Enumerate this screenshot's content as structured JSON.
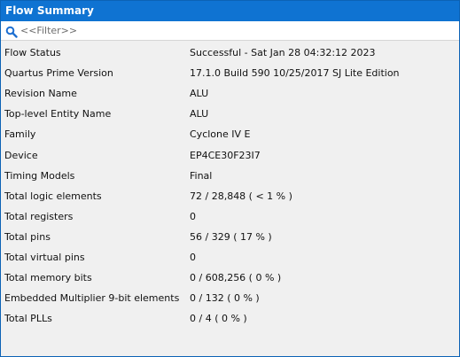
{
  "window": {
    "title": "Flow Summary"
  },
  "filter": {
    "placeholder": "<<Filter>>",
    "icon": "search-icon"
  },
  "summary": {
    "rows": [
      {
        "label": "Flow Status",
        "value": "Successful - Sat Jan 28 04:32:12 2023"
      },
      {
        "label": "Quartus Prime Version",
        "value": "17.1.0 Build 590 10/25/2017 SJ Lite Edition"
      },
      {
        "label": "Revision Name",
        "value": "ALU"
      },
      {
        "label": "Top-level Entity Name",
        "value": "ALU"
      },
      {
        "label": "Family",
        "value": "Cyclone IV E"
      },
      {
        "label": "Device",
        "value": "EP4CE30F23I7"
      },
      {
        "label": "Timing Models",
        "value": "Final"
      },
      {
        "label": "Total logic elements",
        "value": "72 / 28,848 ( < 1 % )"
      },
      {
        "label": "Total registers",
        "value": "0"
      },
      {
        "label": "Total pins",
        "value": "56 / 329 ( 17 % )"
      },
      {
        "label": "Total virtual pins",
        "value": "0"
      },
      {
        "label": "Total memory bits",
        "value": "0 / 608,256 ( 0 % )"
      },
      {
        "label": "Embedded Multiplier 9-bit elements",
        "value": "0 / 132 ( 0 % )"
      },
      {
        "label": "Total PLLs",
        "value": "0 / 4 ( 0 % )"
      }
    ]
  },
  "colors": {
    "titlebar": "#0f73d2",
    "background": "#f0f0f0"
  }
}
